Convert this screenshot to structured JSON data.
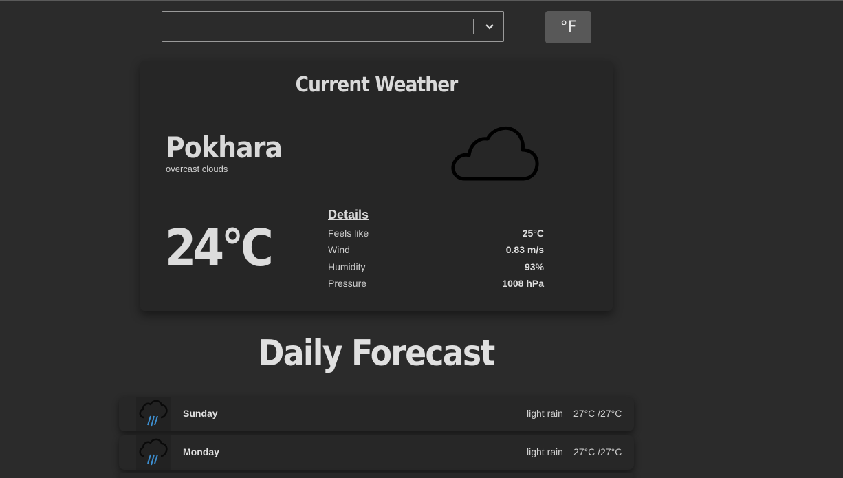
{
  "search": {
    "value": "",
    "placeholder": ""
  },
  "unit_toggle": {
    "label": "°F"
  },
  "current": {
    "title": "Current Weather",
    "city": "Pokhara",
    "description": "overcast clouds",
    "icon": "cloud-icon",
    "temperature": "24°C",
    "details": {
      "heading": "Details",
      "rows": [
        {
          "label": "Feels like",
          "value": "25°C"
        },
        {
          "label": "Wind",
          "value": "0.83 m/s"
        },
        {
          "label": "Humidity",
          "value": "93%"
        },
        {
          "label": "Pressure",
          "value": "1008 hPa"
        }
      ]
    }
  },
  "forecast": {
    "heading": "Daily Forecast",
    "days": [
      {
        "day": "Sunday",
        "description": "light rain",
        "temp": "27°C /27°C",
        "icon": "rain-cloud-icon"
      },
      {
        "day": "Monday",
        "description": "light rain",
        "temp": "27°C /27°C",
        "icon": "rain-cloud-icon"
      }
    ]
  },
  "colors": {
    "background": "#2b2b2b",
    "card": "#262626",
    "toggle": "#585858",
    "rain": "#3d8fd1"
  }
}
